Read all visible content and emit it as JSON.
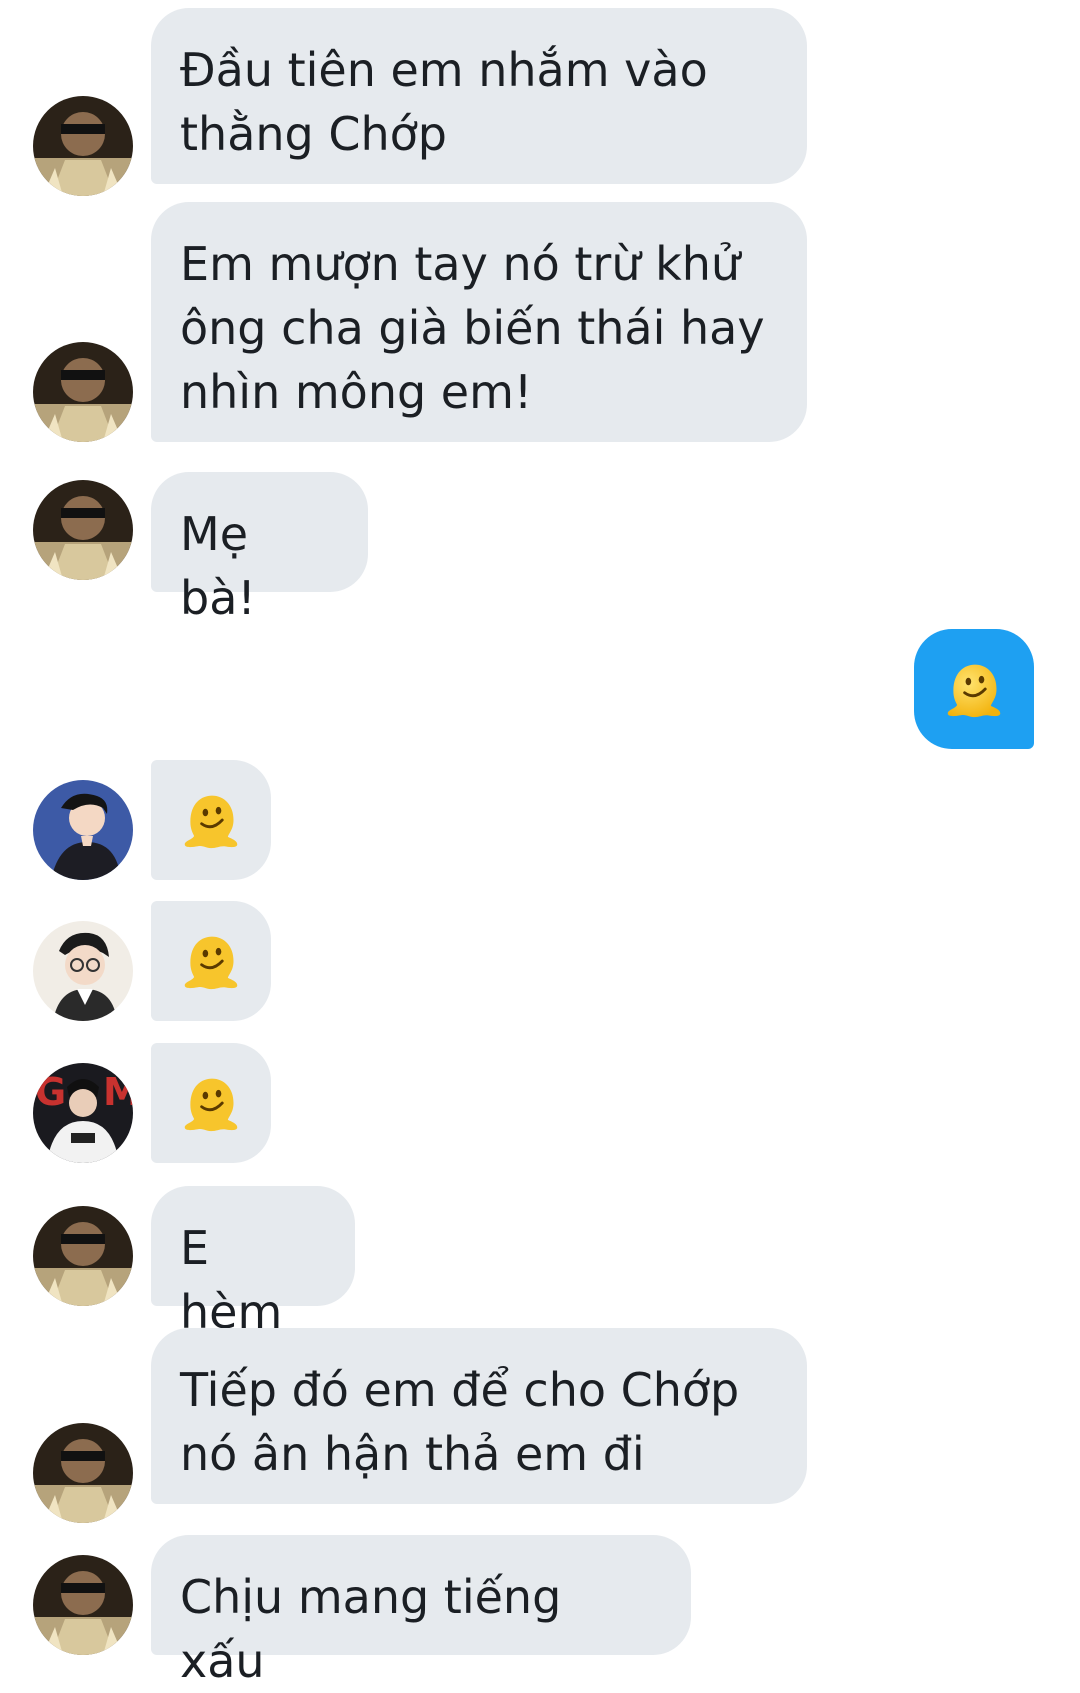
{
  "conversation": {
    "messages": [
      {
        "sender": "incoming",
        "avatar": "dark-avatar",
        "text": "Đầu tiên em nhắm vào\nthằng Chớp"
      },
      {
        "sender": "incoming",
        "avatar": "dark-avatar",
        "text": "Em mượn tay nó trừ khử\nông cha già biến thái hay\nnhìn mông em!"
      },
      {
        "sender": "incoming",
        "avatar": "dark-avatar",
        "text": "Mẹ bà!"
      },
      {
        "sender": "outgoing",
        "emoji": "melting-face-emoji"
      },
      {
        "sender": "incoming",
        "avatar": "blue-avatar",
        "emoji": "melting-face-emoji"
      },
      {
        "sender": "incoming",
        "avatar": "glasses-avatar",
        "emoji": "melting-face-emoji"
      },
      {
        "sender": "incoming",
        "avatar": "gm-avatar",
        "emoji": "melting-face-emoji",
        "avatar_text": "G M"
      },
      {
        "sender": "incoming",
        "avatar": "dark-avatar",
        "text": "E hèm"
      },
      {
        "sender": "incoming",
        "avatar": "dark-avatar",
        "text": "Tiếp đó em để cho Chớp\nnó ân hận thả em đi"
      },
      {
        "sender": "incoming",
        "avatar": "dark-avatar",
        "text": "Chịu mang tiếng xấu"
      }
    ]
  },
  "colors": {
    "incoming_bubble": "#e6eaee",
    "outgoing_bubble": "#1ea0f2",
    "text": "#1b1f24",
    "background": "#ffffff"
  }
}
